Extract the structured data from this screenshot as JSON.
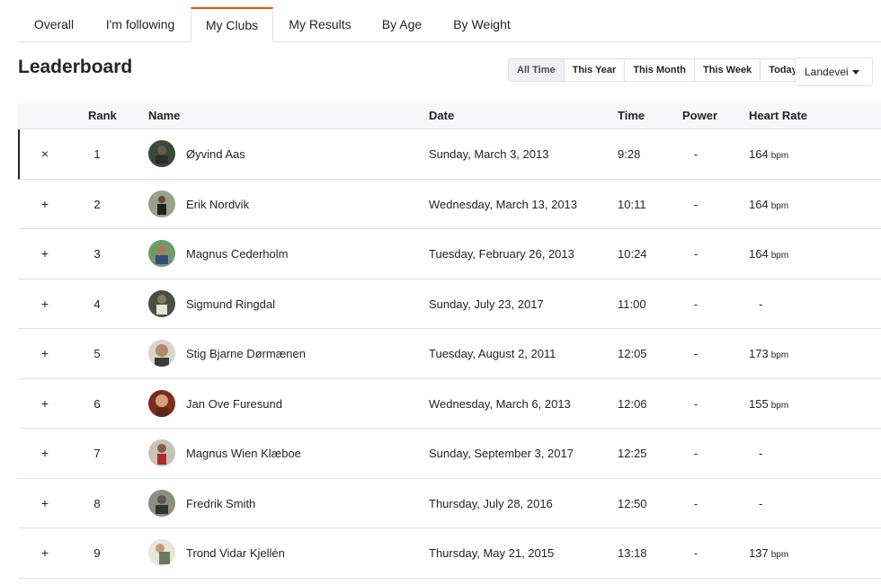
{
  "tabs": [
    {
      "label": "Overall",
      "active": false
    },
    {
      "label": "I'm following",
      "active": false
    },
    {
      "label": "My Clubs",
      "active": true
    },
    {
      "label": "My Results",
      "active": false
    },
    {
      "label": "By Age",
      "active": false
    },
    {
      "label": "By Weight",
      "active": false
    }
  ],
  "page_title": "Leaderboard",
  "filters": [
    {
      "label": "All Time",
      "active": true
    },
    {
      "label": "This Year",
      "active": false
    },
    {
      "label": "This Month",
      "active": false
    },
    {
      "label": "This Week",
      "active": false
    },
    {
      "label": "Today",
      "active": false
    }
  ],
  "select": {
    "value": "Landevei"
  },
  "table": {
    "headers": {
      "rank": "Rank",
      "name": "Name",
      "date": "Date",
      "time": "Time",
      "power": "Power",
      "heart_rate": "Heart Rate"
    },
    "rows": [
      {
        "toggle": "×",
        "rank": "1",
        "name": "Øyvind Aas",
        "date": "Sunday, March 3, 2013",
        "time": "9:28",
        "power": "-",
        "hr": "164",
        "unit": "bpm",
        "selected": true
      },
      {
        "toggle": "+",
        "rank": "2",
        "name": "Erik Nordvik",
        "date": "Wednesday, March 13, 2013",
        "time": "10:11",
        "power": "-",
        "hr": "164",
        "unit": "bpm",
        "selected": false
      },
      {
        "toggle": "+",
        "rank": "3",
        "name": "Magnus Cederholm",
        "date": "Tuesday, February 26, 2013",
        "time": "10:24",
        "power": "-",
        "hr": "164",
        "unit": "bpm",
        "selected": false
      },
      {
        "toggle": "+",
        "rank": "4",
        "name": "Sigmund Ringdal",
        "date": "Sunday, July 23, 2017",
        "time": "11:00",
        "power": "-",
        "hr": "-",
        "unit": "",
        "selected": false
      },
      {
        "toggle": "+",
        "rank": "5",
        "name": "Stig Bjarne Dørmænen",
        "date": "Tuesday, August 2, 2011",
        "time": "12:05",
        "power": "-",
        "hr": "173",
        "unit": "bpm",
        "selected": false
      },
      {
        "toggle": "+",
        "rank": "6",
        "name": "Jan Ove Furesund",
        "date": "Wednesday, March 6, 2013",
        "time": "12:06",
        "power": "-",
        "hr": "155",
        "unit": "bpm",
        "selected": false
      },
      {
        "toggle": "+",
        "rank": "7",
        "name": "Magnus Wien Klæboe",
        "date": "Sunday, September 3, 2017",
        "time": "12:25",
        "power": "-",
        "hr": "-",
        "unit": "",
        "selected": false
      },
      {
        "toggle": "+",
        "rank": "8",
        "name": "Fredrik Smith",
        "date": "Thursday, July 28, 2016",
        "time": "12:50",
        "power": "-",
        "hr": "-",
        "unit": "",
        "selected": false
      },
      {
        "toggle": "+",
        "rank": "9",
        "name": "Trond Vidar Kjellén",
        "date": "Thursday, May 21, 2015",
        "time": "13:18",
        "power": "-",
        "hr": "137",
        "unit": "bpm",
        "selected": false
      }
    ]
  },
  "colors": {
    "accent": "#fc5200",
    "text": "#242428",
    "border": "#dfdfe8",
    "header_bg": "#f7f7fa"
  }
}
